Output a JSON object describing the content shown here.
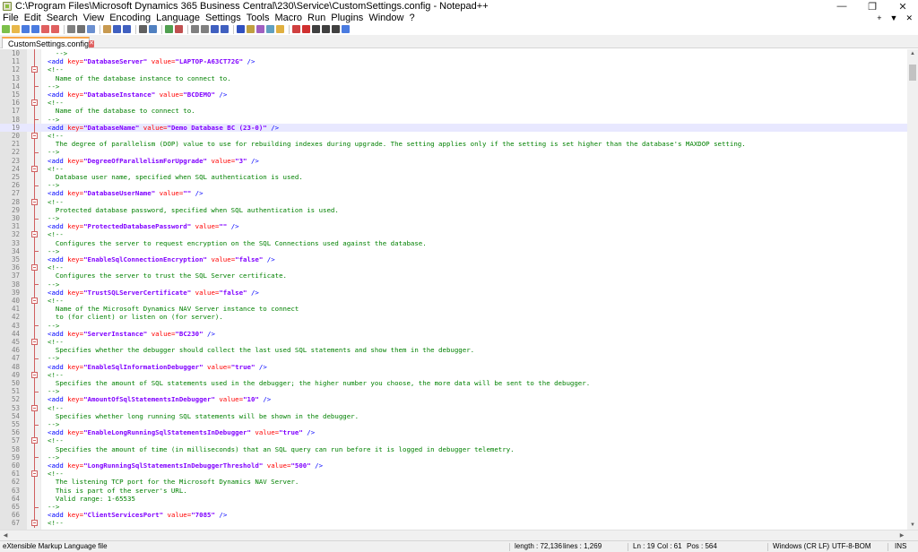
{
  "window": {
    "title": "C:\\Program Files\\Microsoft Dynamics 365 Business Central\\230\\Service\\CustomSettings.config - Notepad++",
    "controls": {
      "minimize": "—",
      "restore": "❐",
      "close": "✕"
    }
  },
  "menu": {
    "items": [
      "File",
      "Edit",
      "Search",
      "View",
      "Encoding",
      "Language",
      "Settings",
      "Tools",
      "Macro",
      "Run",
      "Plugins",
      "Window",
      "?"
    ],
    "right": [
      "+",
      "▼",
      "✕"
    ]
  },
  "toolbar": {
    "icons": [
      {
        "name": "new-file-icon",
        "color": "#7cc04a"
      },
      {
        "name": "open-file-icon",
        "color": "#e8b84a"
      },
      {
        "name": "save-icon",
        "color": "#4a7be0"
      },
      {
        "name": "save-all-icon",
        "color": "#4a7be0"
      },
      {
        "name": "close-icon",
        "color": "#e06060"
      },
      {
        "name": "close-all-icon",
        "color": "#e06060"
      },
      {
        "name": "print-icon",
        "color": "#808080"
      },
      {
        "name": "cut-icon",
        "color": "#707070"
      },
      {
        "name": "copy-icon",
        "color": "#6a8fd0"
      },
      {
        "name": "paste-icon",
        "color": "#c89a50"
      },
      {
        "name": "undo-icon",
        "color": "#4060c0"
      },
      {
        "name": "redo-icon",
        "color": "#4060c0"
      },
      {
        "name": "find-icon",
        "color": "#606060"
      },
      {
        "name": "replace-icon",
        "color": "#5080c0"
      },
      {
        "name": "zoom-in-icon",
        "color": "#50a050"
      },
      {
        "name": "zoom-out-icon",
        "color": "#c05050"
      },
      {
        "name": "sync-vertical-icon",
        "color": "#808080"
      },
      {
        "name": "sync-horizontal-icon",
        "color": "#808080"
      },
      {
        "name": "word-wrap-icon",
        "color": "#4060c0"
      },
      {
        "name": "show-all-chars-icon",
        "color": "#4060c0"
      },
      {
        "name": "indent-guide-icon",
        "color": "#3050c0"
      },
      {
        "name": "lang-icon",
        "color": "#c0a040"
      },
      {
        "name": "doc-map-icon",
        "color": "#a060c0"
      },
      {
        "name": "function-list-icon",
        "color": "#60a0c0"
      },
      {
        "name": "folder-workspace-icon",
        "color": "#e0b040"
      },
      {
        "name": "monitor-icon",
        "color": "#d04040"
      },
      {
        "name": "record-macro-icon",
        "color": "#d03030"
      },
      {
        "name": "stop-macro-icon",
        "color": "#404040"
      },
      {
        "name": "play-macro-icon",
        "color": "#404040"
      },
      {
        "name": "play-multiple-icon",
        "color": "#404040"
      },
      {
        "name": "save-macro-icon",
        "color": "#4a7be0"
      }
    ]
  },
  "tab": {
    "label": "CustomSettings.config",
    "close": "✕"
  },
  "editor": {
    "current_line": 19,
    "lines": [
      {
        "n": "10",
        "fold": "line",
        "parts": [
          {
            "t": "c-comment",
            "s": "  -->"
          }
        ]
      },
      {
        "n": "11",
        "fold": "line",
        "parts": [
          {
            "t": "c-tag",
            "s": "<add "
          },
          {
            "t": "c-attr",
            "s": "key="
          },
          {
            "t": "c-val",
            "s": "\"DatabaseServer\""
          },
          {
            "t": "c-attr",
            "s": " value="
          },
          {
            "t": "c-val",
            "s": "\"LAPTOP-A63CT72G\""
          },
          {
            "t": "c-tag",
            "s": " />"
          }
        ]
      },
      {
        "n": "12",
        "fold": "box",
        "parts": [
          {
            "t": "c-comment",
            "s": "<!--"
          }
        ]
      },
      {
        "n": "13",
        "fold": "line",
        "parts": [
          {
            "t": "c-comment",
            "s": "  Name of the database instance to connect to."
          }
        ]
      },
      {
        "n": "14",
        "fold": "end",
        "parts": [
          {
            "t": "c-comment",
            "s": "-->"
          }
        ]
      },
      {
        "n": "15",
        "fold": "line",
        "parts": [
          {
            "t": "c-tag",
            "s": "<add "
          },
          {
            "t": "c-attr",
            "s": "key="
          },
          {
            "t": "c-val",
            "s": "\"DatabaseInstance\""
          },
          {
            "t": "c-attr",
            "s": " value="
          },
          {
            "t": "c-val",
            "s": "\"BCDEMO\""
          },
          {
            "t": "c-tag",
            "s": " />"
          }
        ]
      },
      {
        "n": "16",
        "fold": "box",
        "parts": [
          {
            "t": "c-comment",
            "s": "<!--"
          }
        ]
      },
      {
        "n": "17",
        "fold": "line",
        "parts": [
          {
            "t": "c-comment",
            "s": "  Name of the database to connect to."
          }
        ]
      },
      {
        "n": "18",
        "fold": "end",
        "parts": [
          {
            "t": "c-comment",
            "s": "-->"
          }
        ]
      },
      {
        "n": "19",
        "fold": "line",
        "parts": [
          {
            "t": "c-tag",
            "s": "<add "
          },
          {
            "t": "c-attr",
            "s": "key="
          },
          {
            "t": "c-val",
            "s": "\"DatabaseName\""
          },
          {
            "t": "c-attr",
            "s": " value="
          },
          {
            "t": "c-val",
            "s": "\"Demo Database BC (23-0)\""
          },
          {
            "t": "c-tag",
            "s": " />"
          }
        ]
      },
      {
        "n": "20",
        "fold": "box",
        "parts": [
          {
            "t": "c-comment",
            "s": "<!--"
          }
        ]
      },
      {
        "n": "21",
        "fold": "line",
        "parts": [
          {
            "t": "c-comment",
            "s": "  The degree of parallelism (DOP) value to use for rebuilding indexes during upgrade. The setting applies only if the setting is set higher than the database's MAXDOP setting."
          }
        ]
      },
      {
        "n": "22",
        "fold": "end",
        "parts": [
          {
            "t": "c-comment",
            "s": "-->"
          }
        ]
      },
      {
        "n": "23",
        "fold": "line",
        "parts": [
          {
            "t": "c-tag",
            "s": "<add "
          },
          {
            "t": "c-attr",
            "s": "key="
          },
          {
            "t": "c-val",
            "s": "\"DegreeOfParallelismForUpgrade\""
          },
          {
            "t": "c-attr",
            "s": " value="
          },
          {
            "t": "c-val",
            "s": "\"3\""
          },
          {
            "t": "c-tag",
            "s": " />"
          }
        ]
      },
      {
        "n": "24",
        "fold": "box",
        "parts": [
          {
            "t": "c-comment",
            "s": "<!--"
          }
        ]
      },
      {
        "n": "25",
        "fold": "line",
        "parts": [
          {
            "t": "c-comment",
            "s": "  Database user name, specified when SQL authentication is used."
          }
        ]
      },
      {
        "n": "26",
        "fold": "end",
        "parts": [
          {
            "t": "c-comment",
            "s": "-->"
          }
        ]
      },
      {
        "n": "27",
        "fold": "line",
        "parts": [
          {
            "t": "c-tag",
            "s": "<add "
          },
          {
            "t": "c-attr",
            "s": "key="
          },
          {
            "t": "c-val",
            "s": "\"DatabaseUserName\""
          },
          {
            "t": "c-attr",
            "s": " value="
          },
          {
            "t": "c-val",
            "s": "\"\""
          },
          {
            "t": "c-tag",
            "s": " />"
          }
        ]
      },
      {
        "n": "28",
        "fold": "box",
        "parts": [
          {
            "t": "c-comment",
            "s": "<!--"
          }
        ]
      },
      {
        "n": "29",
        "fold": "line",
        "parts": [
          {
            "t": "c-comment",
            "s": "  Protected database password, specified when SQL authentication is used."
          }
        ]
      },
      {
        "n": "30",
        "fold": "end",
        "parts": [
          {
            "t": "c-comment",
            "s": "-->"
          }
        ]
      },
      {
        "n": "31",
        "fold": "line",
        "parts": [
          {
            "t": "c-tag",
            "s": "<add "
          },
          {
            "t": "c-attr",
            "s": "key="
          },
          {
            "t": "c-val",
            "s": "\"ProtectedDatabasePassword\""
          },
          {
            "t": "c-attr",
            "s": " value="
          },
          {
            "t": "c-val",
            "s": "\"\""
          },
          {
            "t": "c-tag",
            "s": " />"
          }
        ]
      },
      {
        "n": "32",
        "fold": "box",
        "parts": [
          {
            "t": "c-comment",
            "s": "<!--"
          }
        ]
      },
      {
        "n": "33",
        "fold": "line",
        "parts": [
          {
            "t": "c-comment",
            "s": "  Configures the server to request encryption on the SQL Connections used against the database."
          }
        ]
      },
      {
        "n": "34",
        "fold": "end",
        "parts": [
          {
            "t": "c-comment",
            "s": "-->"
          }
        ]
      },
      {
        "n": "35",
        "fold": "line",
        "parts": [
          {
            "t": "c-tag",
            "s": "<add "
          },
          {
            "t": "c-attr",
            "s": "key="
          },
          {
            "t": "c-val",
            "s": "\"EnableSqlConnectionEncryption\""
          },
          {
            "t": "c-attr",
            "s": " value="
          },
          {
            "t": "c-val",
            "s": "\"false\""
          },
          {
            "t": "c-tag",
            "s": " />"
          }
        ]
      },
      {
        "n": "36",
        "fold": "box",
        "parts": [
          {
            "t": "c-comment",
            "s": "<!--"
          }
        ]
      },
      {
        "n": "37",
        "fold": "line",
        "parts": [
          {
            "t": "c-comment",
            "s": "  Configures the server to trust the SQL Server certificate."
          }
        ]
      },
      {
        "n": "38",
        "fold": "end",
        "parts": [
          {
            "t": "c-comment",
            "s": "-->"
          }
        ]
      },
      {
        "n": "39",
        "fold": "line",
        "parts": [
          {
            "t": "c-tag",
            "s": "<add "
          },
          {
            "t": "c-attr",
            "s": "key="
          },
          {
            "t": "c-val",
            "s": "\"TrustSQLServerCertificate\""
          },
          {
            "t": "c-attr",
            "s": " value="
          },
          {
            "t": "c-val",
            "s": "\"false\""
          },
          {
            "t": "c-tag",
            "s": " />"
          }
        ]
      },
      {
        "n": "40",
        "fold": "box",
        "parts": [
          {
            "t": "c-comment",
            "s": "<!--"
          }
        ]
      },
      {
        "n": "41",
        "fold": "line",
        "parts": [
          {
            "t": "c-comment",
            "s": "  Name of the Microsoft Dynamics NAV Server instance to connect"
          }
        ]
      },
      {
        "n": "42",
        "fold": "line",
        "parts": [
          {
            "t": "c-comment",
            "s": "  to (for client) or listen on (for server)."
          }
        ]
      },
      {
        "n": "43",
        "fold": "end",
        "parts": [
          {
            "t": "c-comment",
            "s": "-->"
          }
        ]
      },
      {
        "n": "44",
        "fold": "line",
        "parts": [
          {
            "t": "c-tag",
            "s": "<add "
          },
          {
            "t": "c-attr",
            "s": "key="
          },
          {
            "t": "c-val",
            "s": "\"ServerInstance\""
          },
          {
            "t": "c-attr",
            "s": " value="
          },
          {
            "t": "c-val",
            "s": "\"BC230\""
          },
          {
            "t": "c-tag",
            "s": " />"
          }
        ]
      },
      {
        "n": "45",
        "fold": "box",
        "parts": [
          {
            "t": "c-comment",
            "s": "<!--"
          }
        ]
      },
      {
        "n": "46",
        "fold": "line",
        "parts": [
          {
            "t": "c-comment",
            "s": "  Specifies whether the debugger should collect the last used SQL statements and show them in the debugger."
          }
        ]
      },
      {
        "n": "47",
        "fold": "end",
        "parts": [
          {
            "t": "c-comment",
            "s": "-->"
          }
        ]
      },
      {
        "n": "48",
        "fold": "line",
        "parts": [
          {
            "t": "c-tag",
            "s": "<add "
          },
          {
            "t": "c-attr",
            "s": "key="
          },
          {
            "t": "c-val",
            "s": "\"EnableSqlInformationDebugger\""
          },
          {
            "t": "c-attr",
            "s": " value="
          },
          {
            "t": "c-val",
            "s": "\"true\""
          },
          {
            "t": "c-tag",
            "s": " />"
          }
        ]
      },
      {
        "n": "49",
        "fold": "box",
        "parts": [
          {
            "t": "c-comment",
            "s": "<!--"
          }
        ]
      },
      {
        "n": "50",
        "fold": "line",
        "parts": [
          {
            "t": "c-comment",
            "s": "  Specifies the amount of SQL statements used in the debugger; the higher number you choose, the more data will be sent to the debugger."
          }
        ]
      },
      {
        "n": "51",
        "fold": "end",
        "parts": [
          {
            "t": "c-comment",
            "s": "-->"
          }
        ]
      },
      {
        "n": "52",
        "fold": "line",
        "parts": [
          {
            "t": "c-tag",
            "s": "<add "
          },
          {
            "t": "c-attr",
            "s": "key="
          },
          {
            "t": "c-val",
            "s": "\"AmountOfSqlStatementsInDebugger\""
          },
          {
            "t": "c-attr",
            "s": " value="
          },
          {
            "t": "c-val",
            "s": "\"10\""
          },
          {
            "t": "c-tag",
            "s": " />"
          }
        ]
      },
      {
        "n": "53",
        "fold": "box",
        "parts": [
          {
            "t": "c-comment",
            "s": "<!--"
          }
        ]
      },
      {
        "n": "54",
        "fold": "line",
        "parts": [
          {
            "t": "c-comment",
            "s": "  Specifies whether long running SQL statements will be shown in the debugger."
          }
        ]
      },
      {
        "n": "55",
        "fold": "end",
        "parts": [
          {
            "t": "c-comment",
            "s": "-->"
          }
        ]
      },
      {
        "n": "56",
        "fold": "line",
        "parts": [
          {
            "t": "c-tag",
            "s": "<add "
          },
          {
            "t": "c-attr",
            "s": "key="
          },
          {
            "t": "c-val",
            "s": "\"EnableLongRunningSqlStatementsInDebugger\""
          },
          {
            "t": "c-attr",
            "s": " value="
          },
          {
            "t": "c-val",
            "s": "\"true\""
          },
          {
            "t": "c-tag",
            "s": " />"
          }
        ]
      },
      {
        "n": "57",
        "fold": "box",
        "parts": [
          {
            "t": "c-comment",
            "s": "<!--"
          }
        ]
      },
      {
        "n": "58",
        "fold": "line",
        "parts": [
          {
            "t": "c-comment",
            "s": "  Specifies the amount of time (in milliseconds) that an SQL query can run before it is logged in debugger telemetry."
          }
        ]
      },
      {
        "n": "59",
        "fold": "end",
        "parts": [
          {
            "t": "c-comment",
            "s": "-->"
          }
        ]
      },
      {
        "n": "60",
        "fold": "line",
        "parts": [
          {
            "t": "c-tag",
            "s": "<add "
          },
          {
            "t": "c-attr",
            "s": "key="
          },
          {
            "t": "c-val",
            "s": "\"LongRunningSqlStatementsInDebuggerThreshold\""
          },
          {
            "t": "c-attr",
            "s": " value="
          },
          {
            "t": "c-val",
            "s": "\"500\""
          },
          {
            "t": "c-tag",
            "s": " />"
          }
        ]
      },
      {
        "n": "61",
        "fold": "box",
        "parts": [
          {
            "t": "c-comment",
            "s": "<!--"
          }
        ]
      },
      {
        "n": "62",
        "fold": "line",
        "parts": [
          {
            "t": "c-comment",
            "s": "  The listening TCP port for the Microsoft Dynamics NAV Server."
          }
        ]
      },
      {
        "n": "63",
        "fold": "line",
        "parts": [
          {
            "t": "c-comment",
            "s": "  This is part of the server's URL."
          }
        ]
      },
      {
        "n": "64",
        "fold": "line",
        "parts": [
          {
            "t": "c-comment",
            "s": "  Valid range: 1-65535"
          }
        ]
      },
      {
        "n": "65",
        "fold": "end",
        "parts": [
          {
            "t": "c-comment",
            "s": "-->"
          }
        ]
      },
      {
        "n": "66",
        "fold": "line",
        "parts": [
          {
            "t": "c-tag",
            "s": "<add "
          },
          {
            "t": "c-attr",
            "s": "key="
          },
          {
            "t": "c-val",
            "s": "\"ClientServicesPort\""
          },
          {
            "t": "c-attr",
            "s": " value="
          },
          {
            "t": "c-val",
            "s": "\"7085\""
          },
          {
            "t": "c-tag",
            "s": " />"
          }
        ]
      },
      {
        "n": "67",
        "fold": "box",
        "parts": [
          {
            "t": "c-comment",
            "s": "<!--"
          }
        ]
      }
    ]
  },
  "statusbar": {
    "file_type": "eXtensible Markup Language file",
    "length": "length : 72,136",
    "lines": "lines : 1,269",
    "ln": "Ln : 19",
    "col": "Col : 61",
    "pos": "Pos : 564",
    "eol": "Windows (CR LF)",
    "encoding": "UTF-8-BOM",
    "mode": "INS"
  }
}
